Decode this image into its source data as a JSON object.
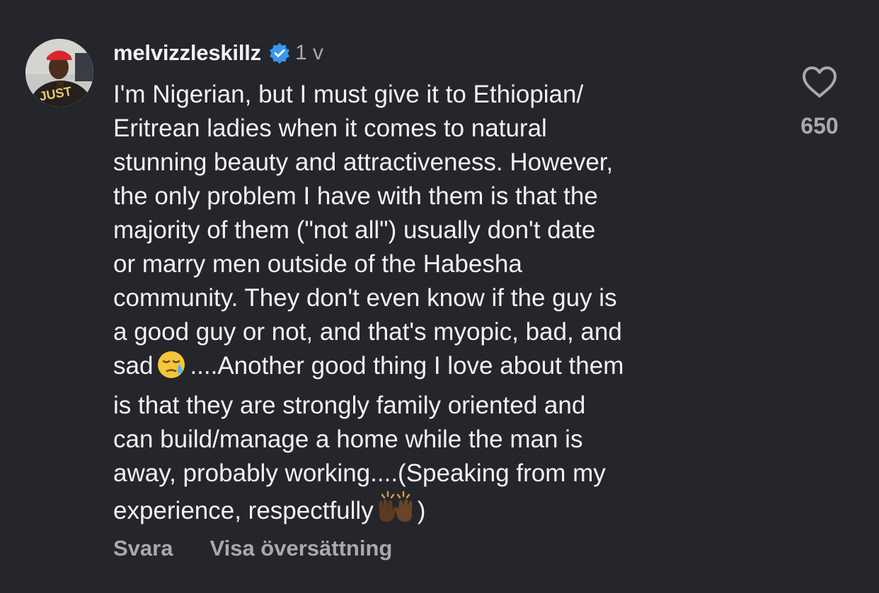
{
  "comment": {
    "username": "melvizzleskillz",
    "verified": true,
    "timestamp": "1 v",
    "avatar": "avatar-photo-red-cap",
    "lines": [
      "I'm Nigerian, but I must give it to Ethiopian/",
      "Eritrean ladies when it comes to natural",
      "stunning beauty and attractiveness. However,",
      "the only problem I have with them is that the",
      "majority of them (\"not all\") usually don't date",
      "or marry men outside of the Habesha",
      "community. They don't even know if the guy is",
      "a good guy or not, and that's myopic, bad, and"
    ],
    "line9_before_emoji": "sad",
    "line9_after_emoji": "....Another good thing I love about them",
    "lines_after": [
      "is that they are strongly family oriented and",
      "can build/manage a home while the man is",
      "away, probably working....(Speaking from my"
    ],
    "last_line_before_emoji": "experience, respectfully",
    "last_line_after_emoji": ")",
    "emoji_1": "sleepy-face-emoji",
    "emoji_2": "raising-hands-emoji"
  },
  "like": {
    "icon": "heart-outline-icon",
    "count": "650"
  },
  "actions": {
    "reply_label": "Svara",
    "translate_label": "Visa översättning"
  },
  "colors": {
    "background": "#25262b",
    "text": "#f2f2f4",
    "muted": "#a8a9ae",
    "verified": "#3897f0"
  }
}
